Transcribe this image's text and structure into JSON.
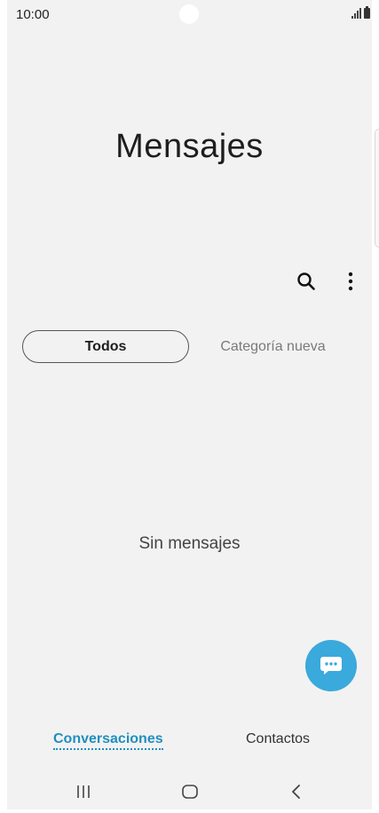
{
  "status_bar": {
    "time": "10:00",
    "signal_icon": "signal-icon",
    "battery_icon": "battery-icon"
  },
  "app": {
    "title": "Mensajes"
  },
  "toolbar": {
    "search_icon": "search-icon",
    "more_icon": "more-vertical-icon"
  },
  "category_tabs": [
    {
      "label": "Todos",
      "selected": true
    },
    {
      "label": "Categoría nueva",
      "selected": false
    }
  ],
  "empty_state": {
    "text": "Sin mensajes"
  },
  "fab": {
    "icon": "compose-message-icon",
    "color": "#3aa9db"
  },
  "bottom_tabs": [
    {
      "label": "Conversaciones",
      "selected": true
    },
    {
      "label": "Contactos",
      "selected": false
    }
  ],
  "navigation": {
    "recent_icon": "recent-apps-icon",
    "home_icon": "home-icon",
    "back_icon": "back-icon"
  },
  "colors": {
    "accent": "#1f8fbf",
    "fab": "#3aa9db",
    "background": "#f2f2f2"
  }
}
